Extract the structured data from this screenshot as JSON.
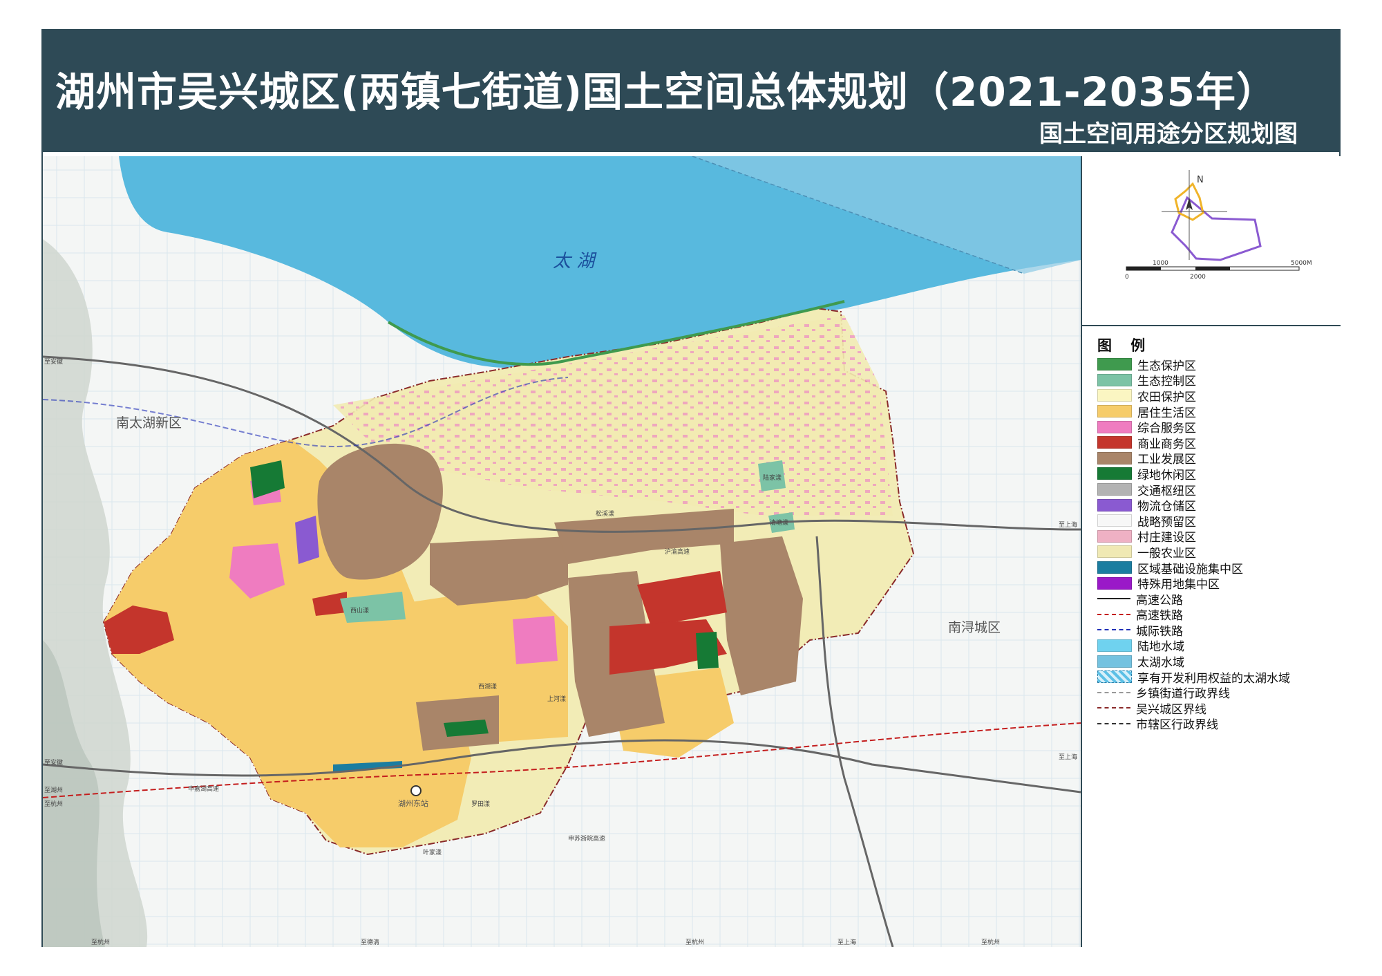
{
  "header": {
    "title": "湖州市吴兴城区(两镇七街道)国土空间总体规划（2021-2035年）",
    "subtitle": "国土空间用途分区规划图"
  },
  "map": {
    "lake_label": "太 湖",
    "place_labels": {
      "nantaihu": "南太湖新区",
      "nanxun": "南浔城区",
      "huzhou_east": "湖州东站"
    },
    "road_labels": {
      "to_anhui_1": "至安徽",
      "to_anhui_2": "至安徽",
      "to_huzhou": "至湖州",
      "to_hangzhou_1": "至杭州",
      "to_hangzhou_2": "至杭州",
      "to_hangzhou_3": "至杭州",
      "to_hangzhou_4": "至杭州",
      "to_shanghai_1": "至上海",
      "to_shanghai_2": "至上海",
      "to_shanghai_3": "至上海",
      "to_deqing": "至德清",
      "shanghu_expressway": "沪渝高速",
      "shenjia_expressway": "申嘉湖高速",
      "shensu_expressway": "申苏浙皖高速"
    },
    "water_labels": [
      "西山漾",
      "西湖漾",
      "上河漾",
      "清塘漾",
      "陆家漾",
      "罗田漾",
      "叶家漾",
      "松溪漾"
    ]
  },
  "scale": {
    "north": "N",
    "label_1000": "1000",
    "label_5000": "5000M",
    "label_0": "0",
    "label_2000": "2000"
  },
  "legend": {
    "title": "图 例",
    "items": [
      {
        "label": "生态保护区",
        "color": "#3f9a4e",
        "kind": "fill"
      },
      {
        "label": "生态控制区",
        "color": "#7cc3a6",
        "kind": "fill"
      },
      {
        "label": "农田保护区",
        "color": "#fbf6c2",
        "kind": "fill"
      },
      {
        "label": "居住生活区",
        "color": "#f6cc6a",
        "kind": "fill"
      },
      {
        "label": "综合服务区",
        "color": "#ef7cc0",
        "kind": "fill"
      },
      {
        "label": "商业商务区",
        "color": "#c4352c",
        "kind": "fill"
      },
      {
        "label": "工业发展区",
        "color": "#a98569",
        "kind": "fill"
      },
      {
        "label": "绿地休闲区",
        "color": "#167a35",
        "kind": "fill"
      },
      {
        "label": "交通枢纽区",
        "color": "#b3b3b3",
        "kind": "fill"
      },
      {
        "label": "物流仓储区",
        "color": "#8a5ad1",
        "kind": "fill"
      },
      {
        "label": "战略预留区",
        "color": "#f7f7f7",
        "kind": "fill"
      },
      {
        "label": "村庄建设区",
        "color": "#efb1c4",
        "kind": "fill"
      },
      {
        "label": "一般农业区",
        "color": "#f0e9b4",
        "kind": "fill"
      },
      {
        "label": "区域基础设施集中区",
        "color": "#1b7da0",
        "kind": "fill"
      },
      {
        "label": "特殊用地集中区",
        "color": "#9a19c8",
        "kind": "fill"
      },
      {
        "label": "高速公路",
        "color": "#222222",
        "kind": "line"
      },
      {
        "label": "高速铁路",
        "color": "#c41e1e",
        "kind": "dash"
      },
      {
        "label": "城际铁路",
        "color": "#1f2fb7",
        "kind": "dash"
      },
      {
        "label": "陆地水域",
        "color": "#6fd2ef",
        "kind": "fill"
      },
      {
        "label": "太湖水域",
        "color": "#74c2e0",
        "kind": "fill"
      },
      {
        "label": "享有开发利用权益的太湖水域",
        "color": "#5cc0e6",
        "kind": "hatch"
      },
      {
        "label": "乡镇街道行政界线",
        "color": "#999999",
        "kind": "dash"
      },
      {
        "label": "吴兴城区界线",
        "color": "#8a2a2a",
        "kind": "dashdot"
      },
      {
        "label": "市辖区行政界线",
        "color": "#333333",
        "kind": "dashdot"
      }
    ]
  }
}
